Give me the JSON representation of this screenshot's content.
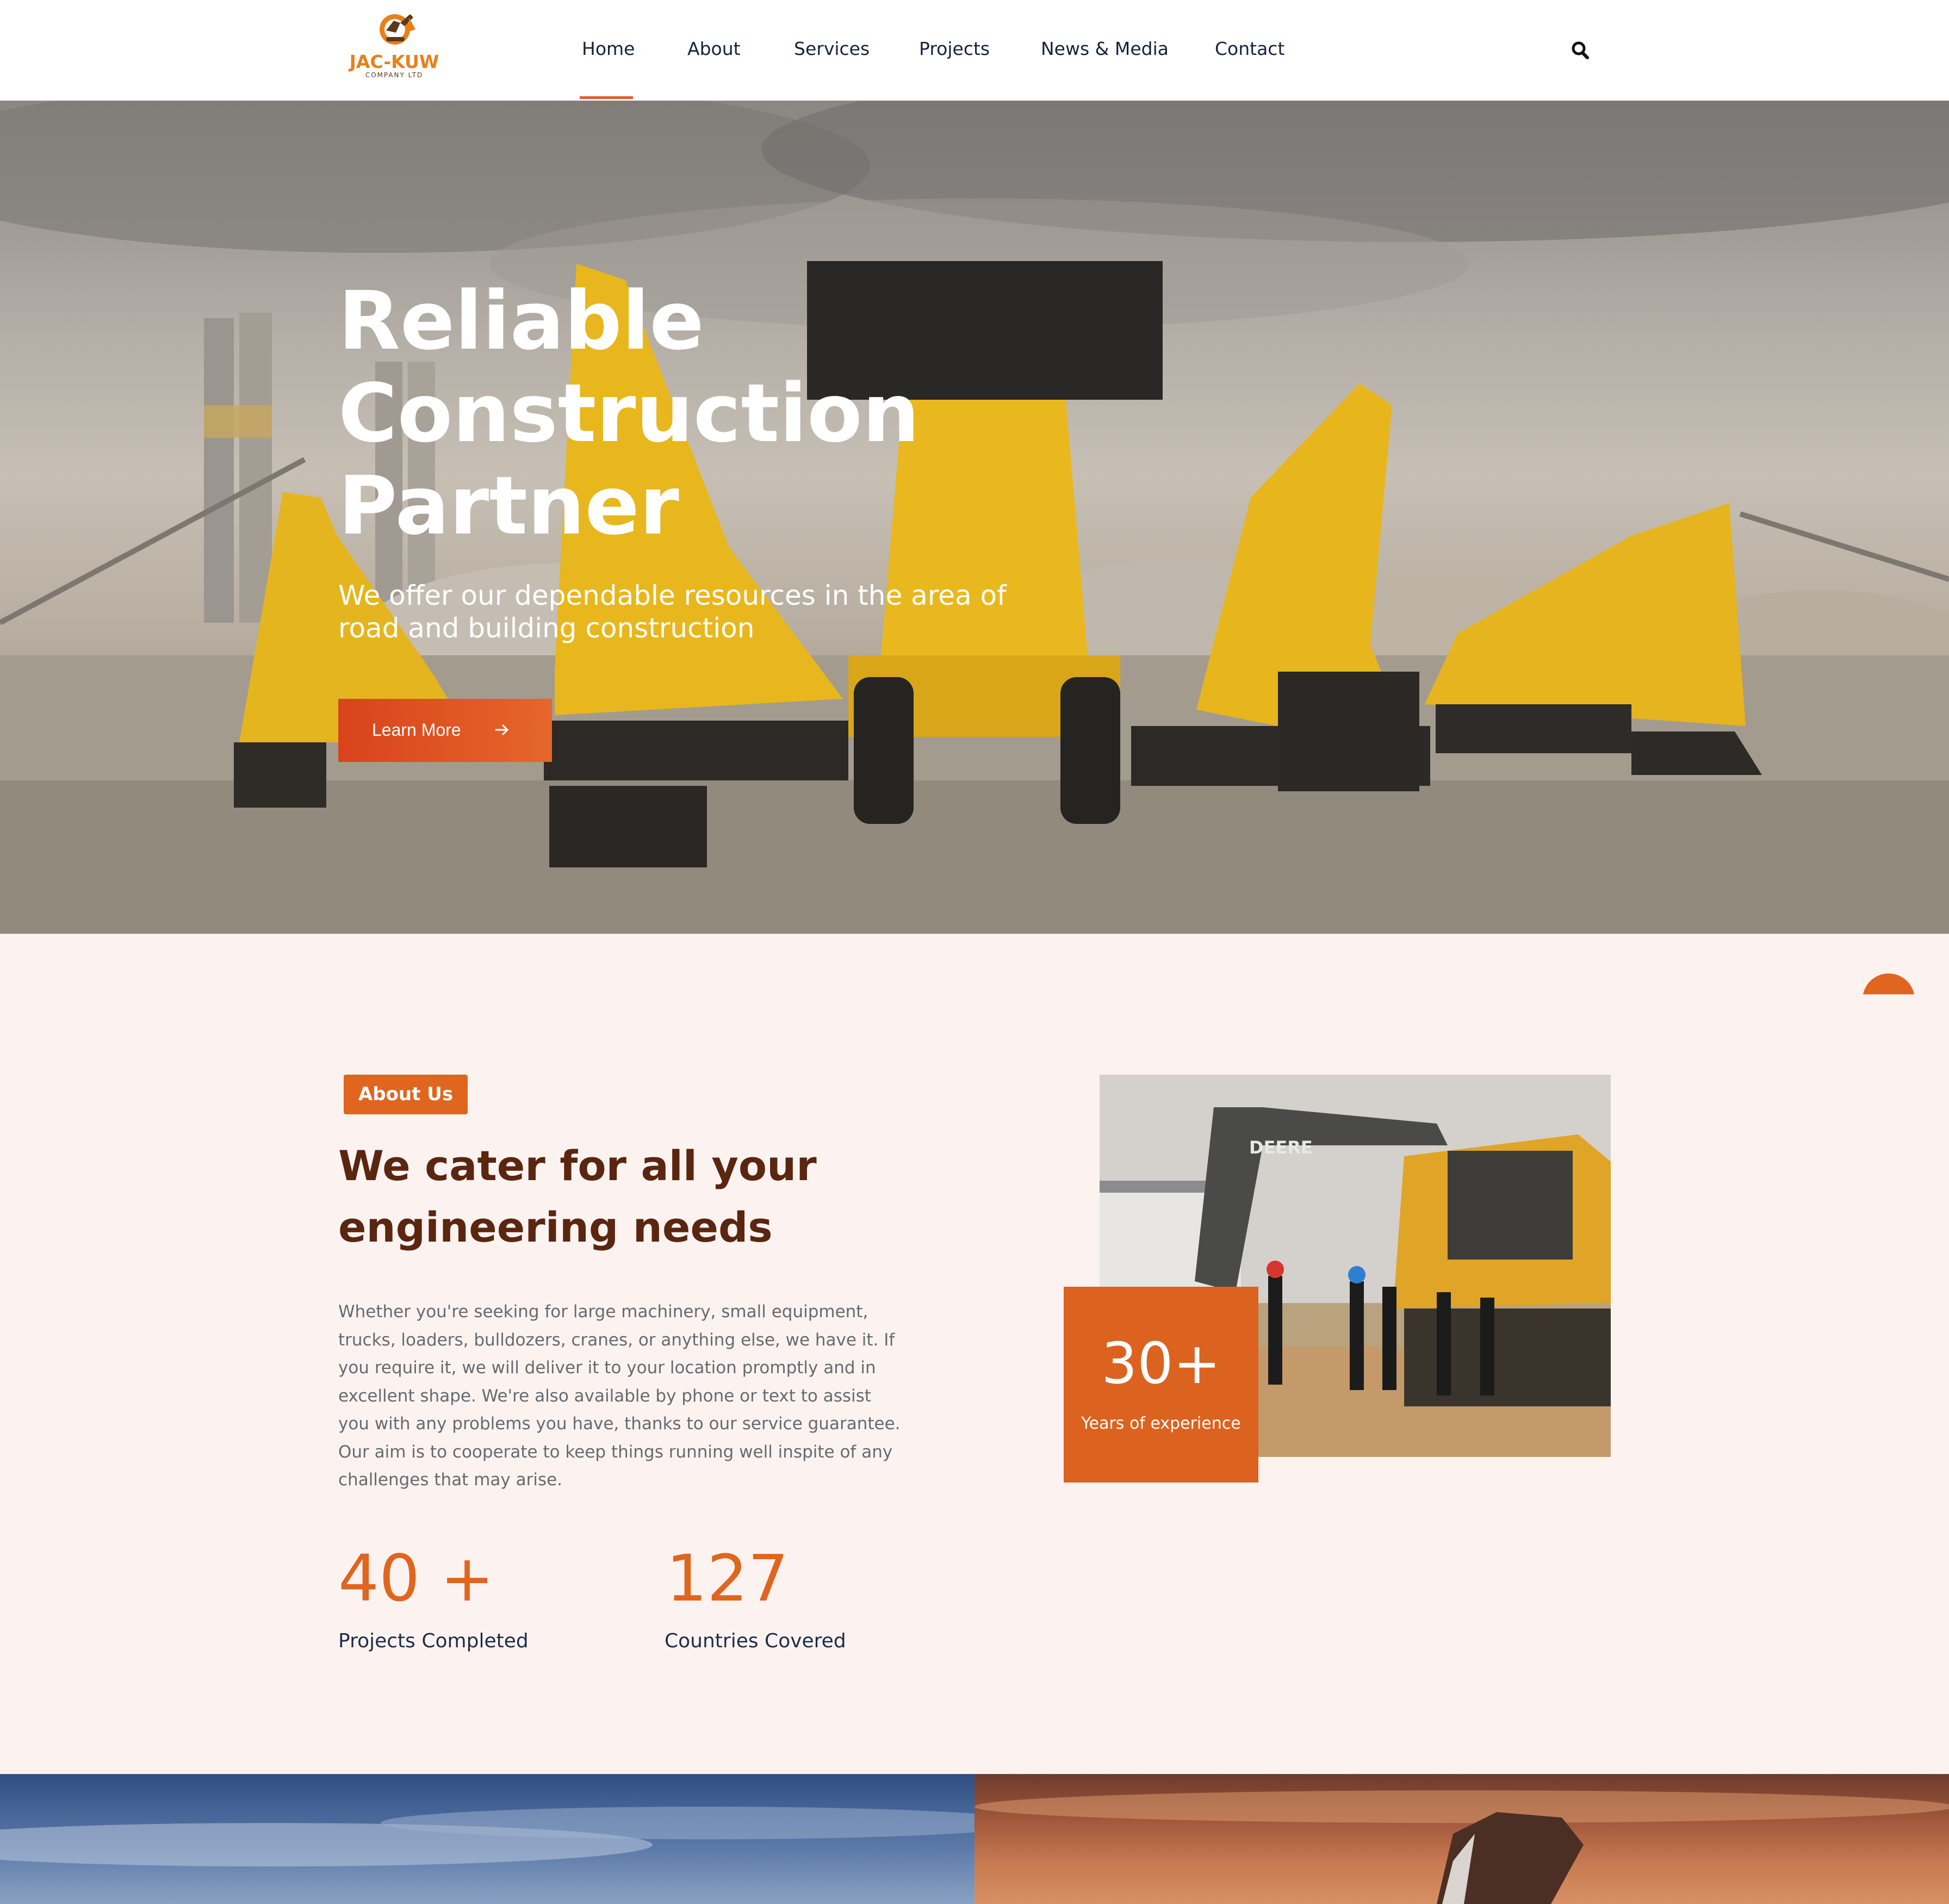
{
  "brand": {
    "name": "JAC-KUW",
    "tagline": "COMPANY LTD",
    "accent_color": "#e0651f",
    "heading_color": "#5a2610",
    "nav_text_color": "#15233a"
  },
  "nav": {
    "items": [
      {
        "label": "Home",
        "active": true
      },
      {
        "label": "About"
      },
      {
        "label": "Services"
      },
      {
        "label": "Projects"
      },
      {
        "label": "News & Media"
      },
      {
        "label": "Contact"
      }
    ],
    "search_icon": "search-icon"
  },
  "hero": {
    "title": "Reliable\nConstruction\nPartner",
    "subtitle": "We offer our dependable resources in the area of road and building construction",
    "cta_label": "Learn More",
    "cta_icon": "arrow-right-icon"
  },
  "about": {
    "badge": "About Us",
    "title": "We cater for all your engineering needs",
    "body": "Whether you're seeking for large machinery, small equipment, trucks, loaders, bulldozers, cranes, or anything else, we have it. If you require it, we will deliver it to your location promptly and in excellent shape. We're also available by phone or text to assist you with any problems you have, thanks to our service guarantee. Our aim is to cooperate to keep things running well inspite of any challenges that may arise.",
    "stats": [
      {
        "value": "40 +",
        "label": "Projects Completed"
      },
      {
        "value": "127",
        "label": "Countries Covered"
      }
    ],
    "experience": {
      "value": "30+",
      "label": "Years of experience"
    },
    "photo_machine_brand": "DEERE"
  }
}
